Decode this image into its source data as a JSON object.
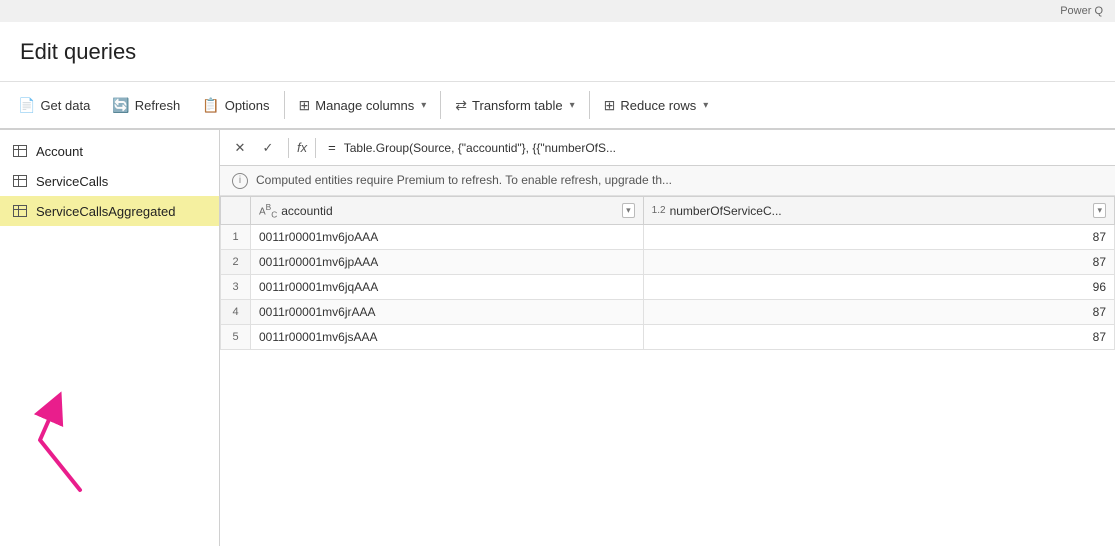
{
  "app": {
    "watermark": "Power Q",
    "title": "Edit queries"
  },
  "toolbar": {
    "buttons": [
      {
        "id": "get-data",
        "label": "Get data",
        "icon": "📄",
        "dropdown": false
      },
      {
        "id": "refresh",
        "label": "Refresh",
        "icon": "🔄",
        "dropdown": false
      },
      {
        "id": "options",
        "label": "Options",
        "icon": "📋",
        "dropdown": false
      },
      {
        "id": "manage-columns",
        "label": "Manage columns",
        "icon": "⊞",
        "dropdown": true
      },
      {
        "id": "transform-table",
        "label": "Transform table",
        "icon": "⇄",
        "dropdown": true
      },
      {
        "id": "reduce-rows",
        "label": "Reduce rows",
        "icon": "⊞",
        "dropdown": true
      }
    ]
  },
  "sidebar": {
    "queries": [
      {
        "id": "account",
        "label": "Account",
        "selected": false
      },
      {
        "id": "service-calls",
        "label": "ServiceCalls",
        "selected": false
      },
      {
        "id": "service-calls-aggregated",
        "label": "ServiceCallsAggregated",
        "selected": true
      }
    ]
  },
  "formula_bar": {
    "cancel_label": "✕",
    "accept_label": "✓",
    "fx_label": "fx",
    "equals": "=",
    "formula": "Table.Group(Source, {\"accountid\"}, {{\"numberOfS..."
  },
  "info_bar": {
    "message": "Computed entities require Premium to refresh. To enable refresh, upgrade th..."
  },
  "table": {
    "columns": [
      {
        "id": "row-num",
        "label": "",
        "type": ""
      },
      {
        "id": "accountid",
        "label": "accountid",
        "type": "ABC",
        "filter": true
      },
      {
        "id": "numberOfServiceC",
        "label": "numberOfServiceC...",
        "type": "1.2",
        "filter": true
      }
    ],
    "rows": [
      {
        "num": 1,
        "accountid": "0011r00001mv6joAAA",
        "numberOfServiceC": 87
      },
      {
        "num": 2,
        "accountid": "0011r00001mv6jpAAA",
        "numberOfServiceC": 87
      },
      {
        "num": 3,
        "accountid": "0011r00001mv6jqAAA",
        "numberOfServiceC": 96
      },
      {
        "num": 4,
        "accountid": "0011r00001mv6jrAAA",
        "numberOfServiceC": 87
      },
      {
        "num": 5,
        "accountid": "0011r00001mv6jsAAA",
        "numberOfServiceC": 87
      }
    ]
  },
  "arrow": {
    "color": "#e91e8c"
  }
}
